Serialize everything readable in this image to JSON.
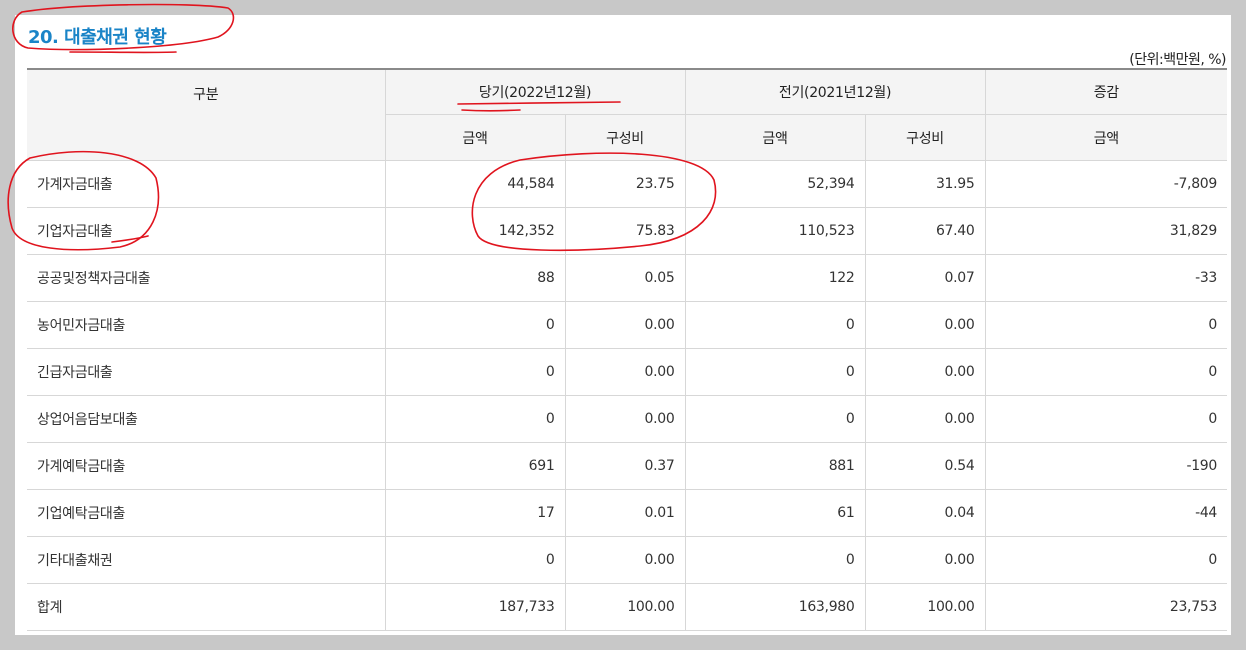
{
  "title": "20. 대출채권 현황",
  "unit": "(단위:백만원, %)",
  "header": {
    "category": "구분",
    "current_period": "당기(2022년12월)",
    "previous_period": "전기(2021년12월)",
    "change": "증감",
    "amount": "금액",
    "ratio": "구성비"
  },
  "rows": [
    {
      "category": "가계자금대출",
      "cur_amount": "44,584",
      "cur_ratio": "23.75",
      "prev_amount": "52,394",
      "prev_ratio": "31.95",
      "change": "-7,809"
    },
    {
      "category": "기업자금대출",
      "cur_amount": "142,352",
      "cur_ratio": "75.83",
      "prev_amount": "110,523",
      "prev_ratio": "67.40",
      "change": "31,829"
    },
    {
      "category": "공공및정책자금대출",
      "cur_amount": "88",
      "cur_ratio": "0.05",
      "prev_amount": "122",
      "prev_ratio": "0.07",
      "change": "-33"
    },
    {
      "category": "농어민자금대출",
      "cur_amount": "0",
      "cur_ratio": "0.00",
      "prev_amount": "0",
      "prev_ratio": "0.00",
      "change": "0"
    },
    {
      "category": "긴급자금대출",
      "cur_amount": "0",
      "cur_ratio": "0.00",
      "prev_amount": "0",
      "prev_ratio": "0.00",
      "change": "0"
    },
    {
      "category": "상업어음담보대출",
      "cur_amount": "0",
      "cur_ratio": "0.00",
      "prev_amount": "0",
      "prev_ratio": "0.00",
      "change": "0"
    },
    {
      "category": "가계예탁금대출",
      "cur_amount": "691",
      "cur_ratio": "0.37",
      "prev_amount": "881",
      "prev_ratio": "0.54",
      "change": "-190"
    },
    {
      "category": "기업예탁금대출",
      "cur_amount": "17",
      "cur_ratio": "0.01",
      "prev_amount": "61",
      "prev_ratio": "0.04",
      "change": "-44"
    },
    {
      "category": "기타대출채권",
      "cur_amount": "0",
      "cur_ratio": "0.00",
      "prev_amount": "0",
      "prev_ratio": "0.00",
      "change": "0"
    },
    {
      "category": "합계",
      "cur_amount": "187,733",
      "cur_ratio": "100.00",
      "prev_amount": "163,980",
      "prev_ratio": "100.00",
      "change": "23,753"
    }
  ],
  "annotation_color": "#e0141e"
}
